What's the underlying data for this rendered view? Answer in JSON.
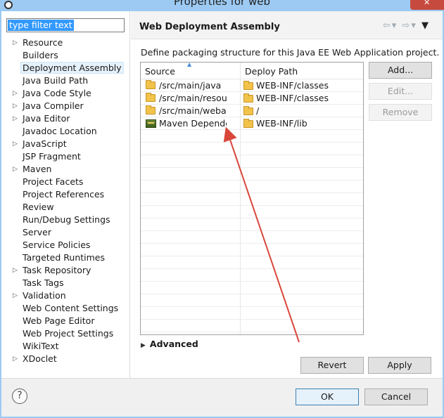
{
  "window": {
    "title": "Properties for web"
  },
  "filter": {
    "value": "type filter text"
  },
  "nav": {
    "items": [
      {
        "label": "Resource",
        "expandable": true
      },
      {
        "label": "Builders",
        "expandable": false
      },
      {
        "label": "Deployment Assembly",
        "expandable": false,
        "selected": true
      },
      {
        "label": "Java Build Path",
        "expandable": false
      },
      {
        "label": "Java Code Style",
        "expandable": true
      },
      {
        "label": "Java Compiler",
        "expandable": true
      },
      {
        "label": "Java Editor",
        "expandable": true
      },
      {
        "label": "Javadoc Location",
        "expandable": false
      },
      {
        "label": "JavaScript",
        "expandable": true
      },
      {
        "label": "JSP Fragment",
        "expandable": false
      },
      {
        "label": "Maven",
        "expandable": true
      },
      {
        "label": "Project Facets",
        "expandable": false
      },
      {
        "label": "Project References",
        "expandable": false
      },
      {
        "label": "Review",
        "expandable": false
      },
      {
        "label": "Run/Debug Settings",
        "expandable": false
      },
      {
        "label": "Server",
        "expandable": false
      },
      {
        "label": "Service Policies",
        "expandable": false
      },
      {
        "label": "Targeted Runtimes",
        "expandable": false
      },
      {
        "label": "Task Repository",
        "expandable": true
      },
      {
        "label": "Task Tags",
        "expandable": false
      },
      {
        "label": "Validation",
        "expandable": true
      },
      {
        "label": "Web Content Settings",
        "expandable": false
      },
      {
        "label": "Web Page Editor",
        "expandable": false
      },
      {
        "label": "Web Project Settings",
        "expandable": false
      },
      {
        "label": "WikiText",
        "expandable": false
      },
      {
        "label": "XDoclet",
        "expandable": true
      }
    ]
  },
  "panel": {
    "title": "Web Deployment Assembly",
    "description": "Define packaging structure for this Java EE Web Application project.",
    "columns": {
      "source": "Source",
      "deploy": "Deploy Path"
    },
    "rows": [
      {
        "source": "/src/main/java",
        "deploy": "WEB-INF/classes",
        "icon": "folder-icon"
      },
      {
        "source": "/src/main/resources",
        "deploy": "WEB-INF/classes",
        "icon": "folder-icon"
      },
      {
        "source": "/src/main/webapp",
        "deploy": "/",
        "icon": "folder-icon"
      },
      {
        "source": "Maven Dependencies",
        "deploy": "WEB-INF/lib",
        "icon": "library-icon"
      }
    ],
    "buttons": {
      "add": "Add...",
      "edit": "Edit...",
      "remove": "Remove"
    },
    "advanced": "Advanced",
    "revert": "Revert",
    "apply": "Apply"
  },
  "footer": {
    "ok": "OK",
    "cancel": "Cancel"
  },
  "colors": {
    "title_bar": "#9ccaf2",
    "close_button": "#c74a3f",
    "selection": "#3399ff",
    "annotation_arrow": "#d9473b"
  }
}
